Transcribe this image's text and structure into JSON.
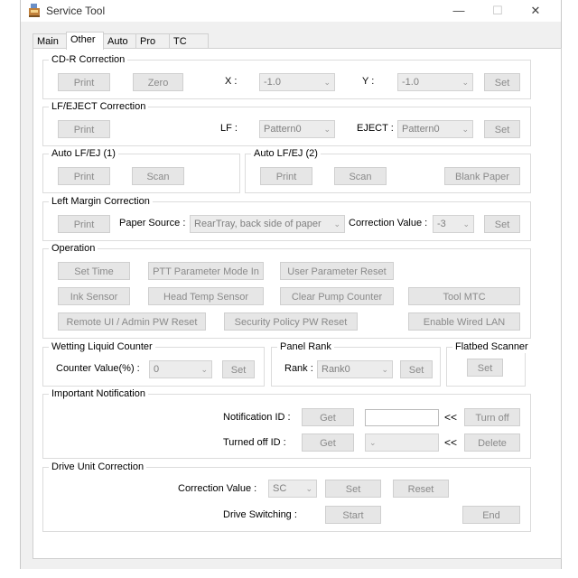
{
  "window": {
    "title": "Service Tool",
    "minimize": "—",
    "maximize": "☐",
    "close": "✕"
  },
  "tabs": [
    "Main",
    "Other",
    "Auto",
    "Pro",
    "TC"
  ],
  "cdr": {
    "title": "CD-R Correction",
    "print": "Print",
    "zero": "Zero",
    "x_label": "X :",
    "x_value": "-1.0",
    "y_label": "Y :",
    "y_value": "-1.0",
    "set": "Set"
  },
  "lfeject": {
    "title": "LF/EJECT Correction",
    "print": "Print",
    "lf_label": "LF :",
    "lf_value": "Pattern0",
    "eject_label": "EJECT :",
    "eject_value": "Pattern0",
    "set": "Set"
  },
  "autolf1": {
    "title": "Auto LF/EJ (1)",
    "print": "Print",
    "scan": "Scan"
  },
  "autolf2": {
    "title": "Auto LF/EJ (2)",
    "print": "Print",
    "scan": "Scan",
    "blank": "Blank Paper"
  },
  "leftmargin": {
    "title": "Left Margin Correction",
    "print": "Print",
    "source_label": "Paper Source :",
    "source_value": "RearTray, back side of paper",
    "corr_label": "Correction Value :",
    "corr_value": "-3",
    "set": "Set"
  },
  "operation": {
    "title": "Operation",
    "set_time": "Set Time",
    "ptt": "PTT Parameter Mode In",
    "user_reset": "User Parameter Reset",
    "ink_sensor": "Ink Sensor",
    "head_temp": "Head Temp Sensor",
    "clear_pump": "Clear Pump Counter",
    "tool_mtc": "Tool MTC",
    "remote_ui": "Remote UI / Admin PW Reset",
    "security": "Security Policy PW Reset",
    "wired_lan": "Enable Wired LAN"
  },
  "wetting": {
    "title": "Wetting Liquid Counter",
    "counter_label": "Counter Value(%) :",
    "counter_value": "0",
    "set": "Set"
  },
  "panelrank": {
    "title": "Panel Rank",
    "rank_label": "Rank :",
    "rank_value": "Rank0",
    "set": "Set"
  },
  "flatbed": {
    "title": "Flatbed Scanner",
    "set": "Set"
  },
  "notification": {
    "title": "Important Notification",
    "id_label": "Notification ID :",
    "get": "Get",
    "arrows": "<<",
    "turn_off": "Turn off",
    "turned_off_label": "Turned off ID :",
    "get2": "Get",
    "delete": "Delete"
  },
  "drive": {
    "title": "Drive Unit Correction",
    "corr_label": "Correction Value :",
    "corr_value": "SC",
    "set": "Set",
    "reset": "Reset",
    "switch_label": "Drive Switching :",
    "start": "Start",
    "end": "End"
  }
}
